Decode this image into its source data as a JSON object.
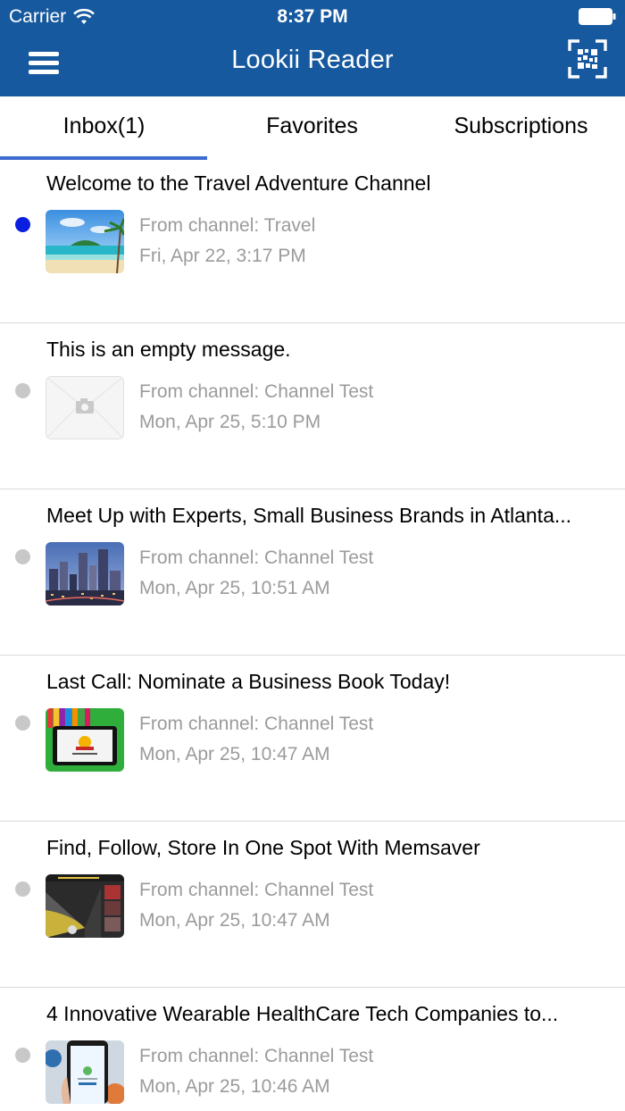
{
  "status_bar": {
    "carrier": "Carrier",
    "time": "8:37 PM"
  },
  "header": {
    "title": "Lookii Reader",
    "menu_icon": "menu-icon",
    "scan_icon": "qr-scan-icon",
    "background": "#17599e"
  },
  "tabs": [
    {
      "label": "Inbox(1)",
      "selected": true
    },
    {
      "label": "Favorites",
      "selected": false
    },
    {
      "label": "Subscriptions",
      "selected": false
    }
  ],
  "messages": [
    {
      "title": "Welcome to the Travel Adventure Channel",
      "from": "From channel: Travel",
      "date": "Fri, Apr 22, 3:17 PM",
      "unread": true,
      "thumbnail": "beach-image"
    },
    {
      "title": "This is an empty message.",
      "from": "From channel: Channel Test",
      "date": "Mon, Apr 25, 5:10 PM",
      "unread": false,
      "thumbnail": "placeholder-camera-image"
    },
    {
      "title": "Meet Up with Experts, Small Business Brands in Atlanta...",
      "from": "From channel: Channel Test",
      "date": "Mon, Apr 25, 10:51 AM",
      "unread": false,
      "thumbnail": "city-skyline-image"
    },
    {
      "title": "Last Call: Nominate a Business Book Today!",
      "from": "From channel: Channel Test",
      "date": "Mon, Apr 25, 10:47 AM",
      "unread": false,
      "thumbnail": "tablet-books-image"
    },
    {
      "title": "Find, Follow, Store In One Spot With Memsaver",
      "from": "From channel: Channel Test",
      "date": "Mon, Apr 25, 10:47 AM",
      "unread": false,
      "thumbnail": "memsaver-image"
    },
    {
      "title": "4 Innovative Wearable HealthCare Tech Companies to...",
      "from": "From channel: Channel Test",
      "date": "Mon, Apr 25, 10:46 AM",
      "unread": false,
      "thumbnail": "phone-impact-image"
    }
  ],
  "colors": {
    "unread_dot": "#0a1fdf",
    "read_dot": "#c8c8c8",
    "tab_indicator": "#3d6bcf"
  }
}
